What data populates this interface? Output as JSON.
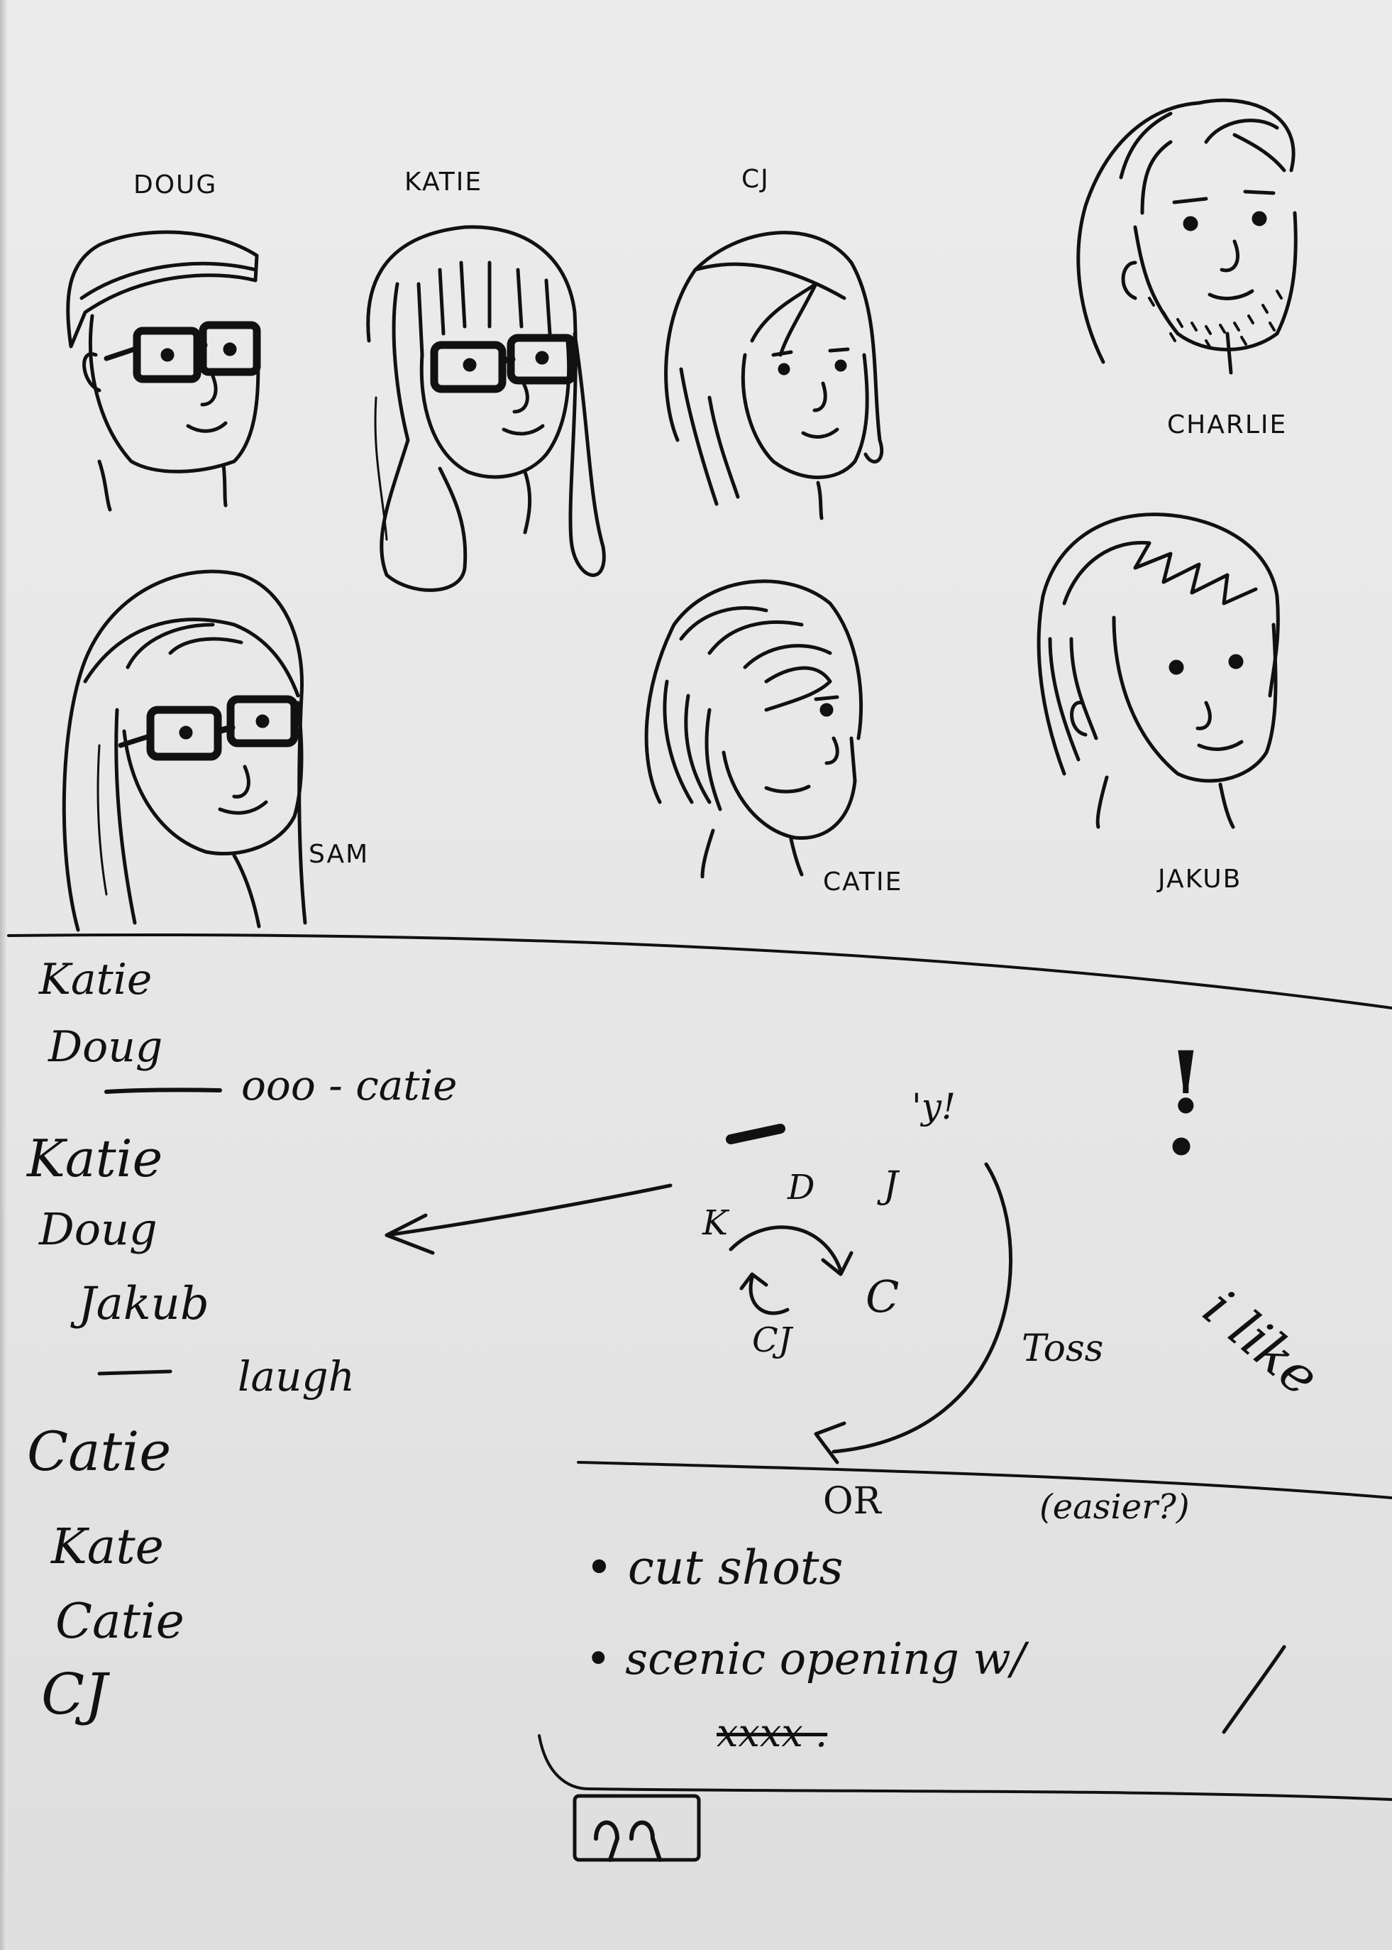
{
  "portraits": [
    {
      "key": "doug",
      "name": "DOUG"
    },
    {
      "key": "katie",
      "name": "KATIE"
    },
    {
      "key": "cj",
      "name": "CJ"
    },
    {
      "key": "charlie",
      "name": "CHARLIE"
    },
    {
      "key": "sam",
      "name": "SAM"
    },
    {
      "key": "catie",
      "name": "CATIE"
    },
    {
      "key": "jakub",
      "name": "JAKUB"
    }
  ],
  "notes": {
    "dialogue_list": [
      "Katie",
      "Doug",
      "Katie",
      "Doug",
      "Jakub",
      "laugh",
      "Catie",
      "Kate",
      "Catie",
      "CJ"
    ],
    "doug_aside": "ooo - catie",
    "diagram": {
      "k": "K",
      "d": "D",
      "j": "J",
      "c": "C",
      "cj": "CJ",
      "yell": "'y!",
      "toss": "Toss"
    },
    "exclaim": "!",
    "i_like": "i like",
    "or_label": "OR",
    "easier": "(easier?)",
    "bullets": [
      "cut shots",
      "scenic opening w/"
    ],
    "scribble": "xxxx ."
  },
  "colors": {
    "paper": "#e8e8e8",
    "ink": "#111111"
  }
}
